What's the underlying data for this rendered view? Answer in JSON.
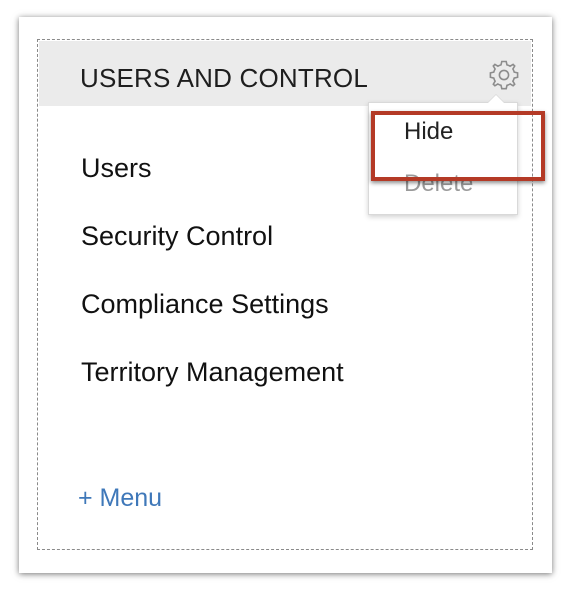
{
  "panel": {
    "title": "USERS AND CONTROL",
    "settings_icon": "gear-icon"
  },
  "menu": {
    "items": [
      {
        "label": "Users"
      },
      {
        "label": "Security Control"
      },
      {
        "label": "Compliance Settings"
      },
      {
        "label": "Territory Management"
      }
    ],
    "add_label": "+ Menu"
  },
  "dropdown": {
    "hide_label": "Hide",
    "delete_label": "Delete"
  },
  "colors": {
    "header_bg": "#ebebeb",
    "link": "#3f78b9",
    "highlight": "#b43a26",
    "disabled_text": "#9a9a9a"
  }
}
